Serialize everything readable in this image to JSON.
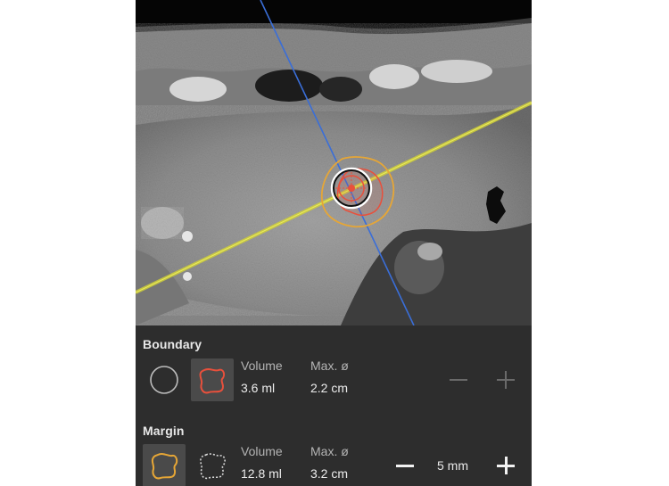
{
  "boundary": {
    "title": "Boundary",
    "volume_label": "Volume",
    "volume_value": "3.6 ml",
    "diameter_label": "Max. ø",
    "diameter_value": "2.2 cm"
  },
  "margin": {
    "title": "Margin",
    "volume_label": "Volume",
    "volume_value": "12.8 ml",
    "diameter_label": "Max. ø",
    "diameter_value": "3.2 cm",
    "size_value": "5 mm"
  },
  "colors": {
    "panel_bg": "#2d2d2d",
    "boundary_red": "#e8503c",
    "margin_orange": "#e6a636",
    "needle_blue": "#3b6fd6",
    "guide_yellow": "#d4d43a"
  },
  "icons": {
    "circle_tool": "circle-outline-icon",
    "boundary_shape": "red-freeform-shape-icon",
    "margin_shape": "orange-freeform-shape-icon",
    "margin_dotted": "dotted-freeform-shape-icon",
    "minus": "minus-icon",
    "plus": "plus-icon"
  }
}
